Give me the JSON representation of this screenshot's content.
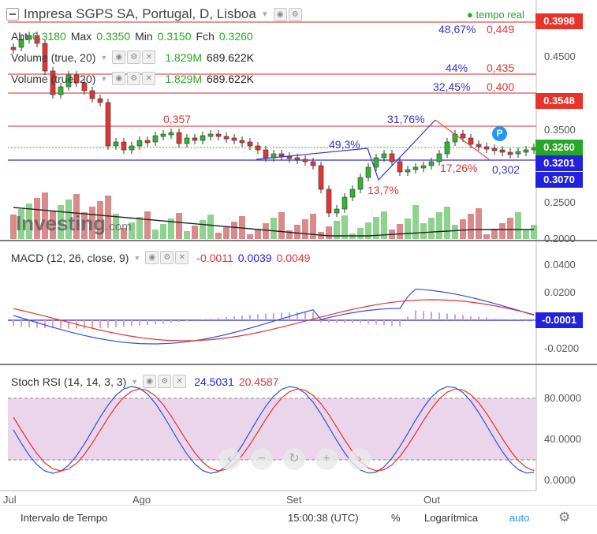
{
  "header": {
    "title": "Impresa SGPS SA, Portugal, D, Lisboa",
    "realtime": "tempo real"
  },
  "ohlc": {
    "a_label": "Abt",
    "a_val": "0.3180",
    "max_label": "Max",
    "max_val": "0.3350",
    "min_label": "Min",
    "min_val": "0.3150",
    "fch_label": "Fch",
    "fch_val": "0.3260"
  },
  "volume_rows": [
    {
      "label": "Volume (true, 20)",
      "v1": "1.829M",
      "v2": "689.622K"
    },
    {
      "label": "Volume (true, 20)",
      "v1": "1.829M",
      "v2": "689.622K"
    }
  ],
  "annotations": {
    "a_0357": "0,357",
    "a_493": "49,3%",
    "a_3176": "31,76%",
    "a_1726": "17,26%",
    "a_0302": "0,302",
    "a_137": "13,7%",
    "fib_4867": "48,67%",
    "fib_0449": "0,449",
    "fib_44": "44%",
    "fib_0435": "0,435",
    "fib_3245": "32,45%",
    "fib_0400": "0,400",
    "p_marker": "P"
  },
  "price_axis": {
    "ticks": [
      "0.4500",
      "0.3500",
      "0.2500",
      "0.2000"
    ],
    "tags": [
      {
        "text": "0.3998",
        "color": "#e8332a"
      },
      {
        "text": "0.3548",
        "color": "#e8332a"
      },
      {
        "text": "0.3260",
        "color": "#27a727"
      },
      {
        "text": "0.3201",
        "color": "#2222dd"
      },
      {
        "text": "0.3070",
        "color": "#2222dd"
      }
    ]
  },
  "macd": {
    "label": "MACD (12, 26, close, 9)",
    "v1": "-0.0011",
    "v2": "0.0039",
    "v3": "0.0049",
    "ticks": [
      "0.0400",
      "0.0200",
      "-0.0200"
    ],
    "tag": "-0.0001"
  },
  "stoch": {
    "label": "Stoch RSI (14, 14, 3, 3)",
    "v1": "24.5031",
    "v2": "20.4587",
    "ticks": [
      "80.0000",
      "40.0000",
      "0.0000"
    ]
  },
  "time_axis": {
    "labels": [
      "Jul",
      "Ago",
      "Set",
      "Out"
    ]
  },
  "watermark": {
    "text": "Investing",
    "suffix": ".com"
  },
  "bottom_bar": {
    "interval": "Intervalo de Tempo",
    "time": "15:00:38 (UTC)",
    "percent": "%",
    "log": "Logarítmica",
    "auto": "auto"
  },
  "colors": {
    "up": "#33b333",
    "down": "#e03535",
    "macd_line": "#3050e0",
    "signal_line": "#e83030",
    "stoch_band": "#ead5ea"
  }
}
